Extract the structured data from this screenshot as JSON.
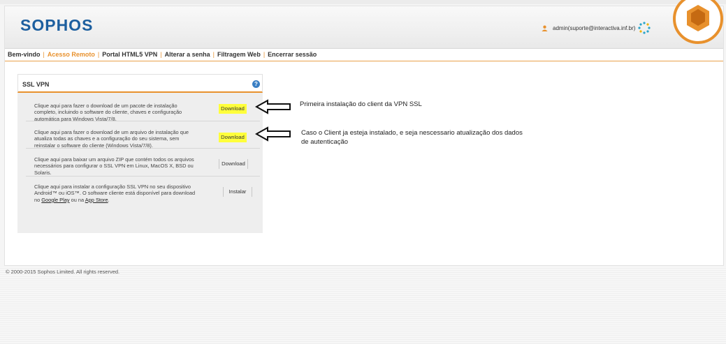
{
  "header": {
    "logo": "SOPHOS",
    "user": "admin(suporte@interactiva.inf.br)"
  },
  "nav": {
    "items": [
      {
        "label": "Bem-vindo",
        "active": false
      },
      {
        "label": "Acesso Remoto",
        "active": true
      },
      {
        "label": "Portal HTML5 VPN",
        "active": false
      },
      {
        "label": "Alterar a senha",
        "active": false
      },
      {
        "label": "Filtragem Web",
        "active": false
      },
      {
        "label": "Encerrar sessão",
        "active": false
      }
    ],
    "separator": "|"
  },
  "panel": {
    "title": "SSL VPN",
    "help": "?",
    "rows": [
      {
        "text": "Clique aqui para fazer o download de um pacote de instalação completo, incluindo o software do cliente, chaves e configuração automática para Windows Vista/7/8.",
        "button": "Download",
        "highlighted": true
      },
      {
        "text": "Clique aqui para fazer o download de um arquivo de instalação que atualiza todas as chaves e a configuração do seu sistema, sem reinstalar o software do cliente (Windows Vista/7/8).",
        "button": "Download",
        "highlighted": true
      },
      {
        "text": "Clique aqui para baixar um arquivo ZIP que contém todos os arquivos necessários para configurar o SSL VPN em Linux, MacOS X, BSD ou Solaris.",
        "button": "Download",
        "highlighted": false
      },
      {
        "text_before": "Clique aqui para instalar a configuração SSL VPN no seu dispositivo Android™ ou iOS™. O software cliente está disponível para download no ",
        "link1": "Google Play",
        "text_middle": " ou na ",
        "link2": "App Store",
        "text_after": ".",
        "button": "Instalar",
        "highlighted": false
      }
    ]
  },
  "annotations": [
    {
      "text": "Primeira instalação do client da VPN SSL"
    },
    {
      "text": "Caso o Client ja esteja instalado, e seja nescessario atualização dos dados de autenticação"
    }
  ],
  "footer": "© 2000-2015 Sophos Limited. All rights reserved.",
  "colors": {
    "brand_blue": "#1d5f9f",
    "accent_orange": "#e8912d",
    "highlight_yellow": "#ffff3b",
    "help_blue": "#3a7fc4"
  }
}
